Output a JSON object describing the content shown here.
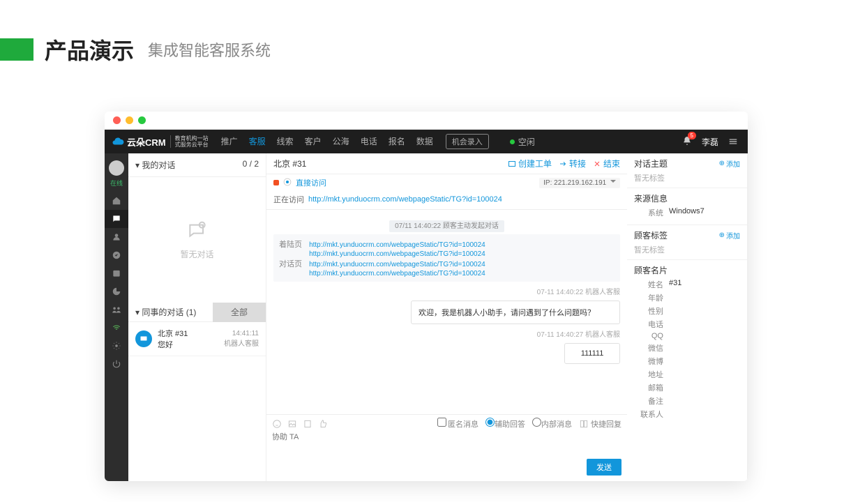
{
  "slide": {
    "title": "产品演示",
    "subtitle": "集成智能客服系统"
  },
  "nav": {
    "brand": "云朵CRM",
    "brandSub1": "教育机构一站",
    "brandSub2": "式服务云平台",
    "items": [
      "推广",
      "客服",
      "线索",
      "客户",
      "公海",
      "电话",
      "报名",
      "数据"
    ],
    "activeIndex": 1,
    "recording": "机会录入",
    "idle": "空闲",
    "bellCount": "5",
    "user": "李磊"
  },
  "iconbar": {
    "onlineLabel": "在线"
  },
  "convList": {
    "mine": {
      "title": "我的对话",
      "count": "0 / 2",
      "empty": "暂无对话"
    },
    "colleague": {
      "title": "同事的对话  (1)",
      "all": "全部",
      "item": {
        "name": "北京 #31",
        "msg": "您好",
        "time": "14:41:11",
        "who": "机器人客服"
      }
    }
  },
  "chat": {
    "title": "北京 #31",
    "actions": {
      "ticket": "创建工单",
      "transfer": "转接",
      "end": "结束"
    },
    "direct": "直接访问",
    "ip": "IP:  221.219.162.191",
    "visiting": "正在访问",
    "visitUrl": "http://mkt.yunduocrm.com/webpageStatic/TG?id=100024",
    "sysTag": "07/11 14:40:22  顾客主动发起对话",
    "urlBlock": {
      "lab1": "着陆页",
      "lab2": "对话页",
      "url": "http://mkt.yunduocrm.com/webpageStatic/TG?id=100024"
    },
    "m1": {
      "ts": "07-11 14:40:22  机器人客服",
      "text": "欢迎，我是机器人小助手，请问遇到了什么问题吗？"
    },
    "m2": {
      "ts": "07-11 14:40:27  机器人客服",
      "text": "111111"
    }
  },
  "composer": {
    "anon": "匿名消息",
    "assist": "辅助回答",
    "internal": "内部消息",
    "quick": "快捷回复",
    "placeholder": "协助 TA",
    "send": "发送"
  },
  "rpanel": {
    "topic": {
      "title": "对话主题",
      "add": "添加",
      "none": "暂无标签"
    },
    "source": {
      "title": "来源信息",
      "sysK": "系统",
      "sysV": "Windows7"
    },
    "tags": {
      "title": "顾客标签",
      "add": "添加",
      "none": "暂无标签"
    },
    "card": {
      "title": "顾客名片",
      "fields": [
        {
          "k": "姓名",
          "v": "#31"
        },
        {
          "k": "年龄",
          "v": ""
        },
        {
          "k": "性别",
          "v": ""
        },
        {
          "k": "电话",
          "v": ""
        },
        {
          "k": "QQ",
          "v": ""
        },
        {
          "k": "微信",
          "v": ""
        },
        {
          "k": "微博",
          "v": ""
        },
        {
          "k": "地址",
          "v": ""
        },
        {
          "k": "邮箱",
          "v": ""
        },
        {
          "k": "备注",
          "v": ""
        },
        {
          "k": "联系人",
          "v": ""
        }
      ]
    }
  }
}
